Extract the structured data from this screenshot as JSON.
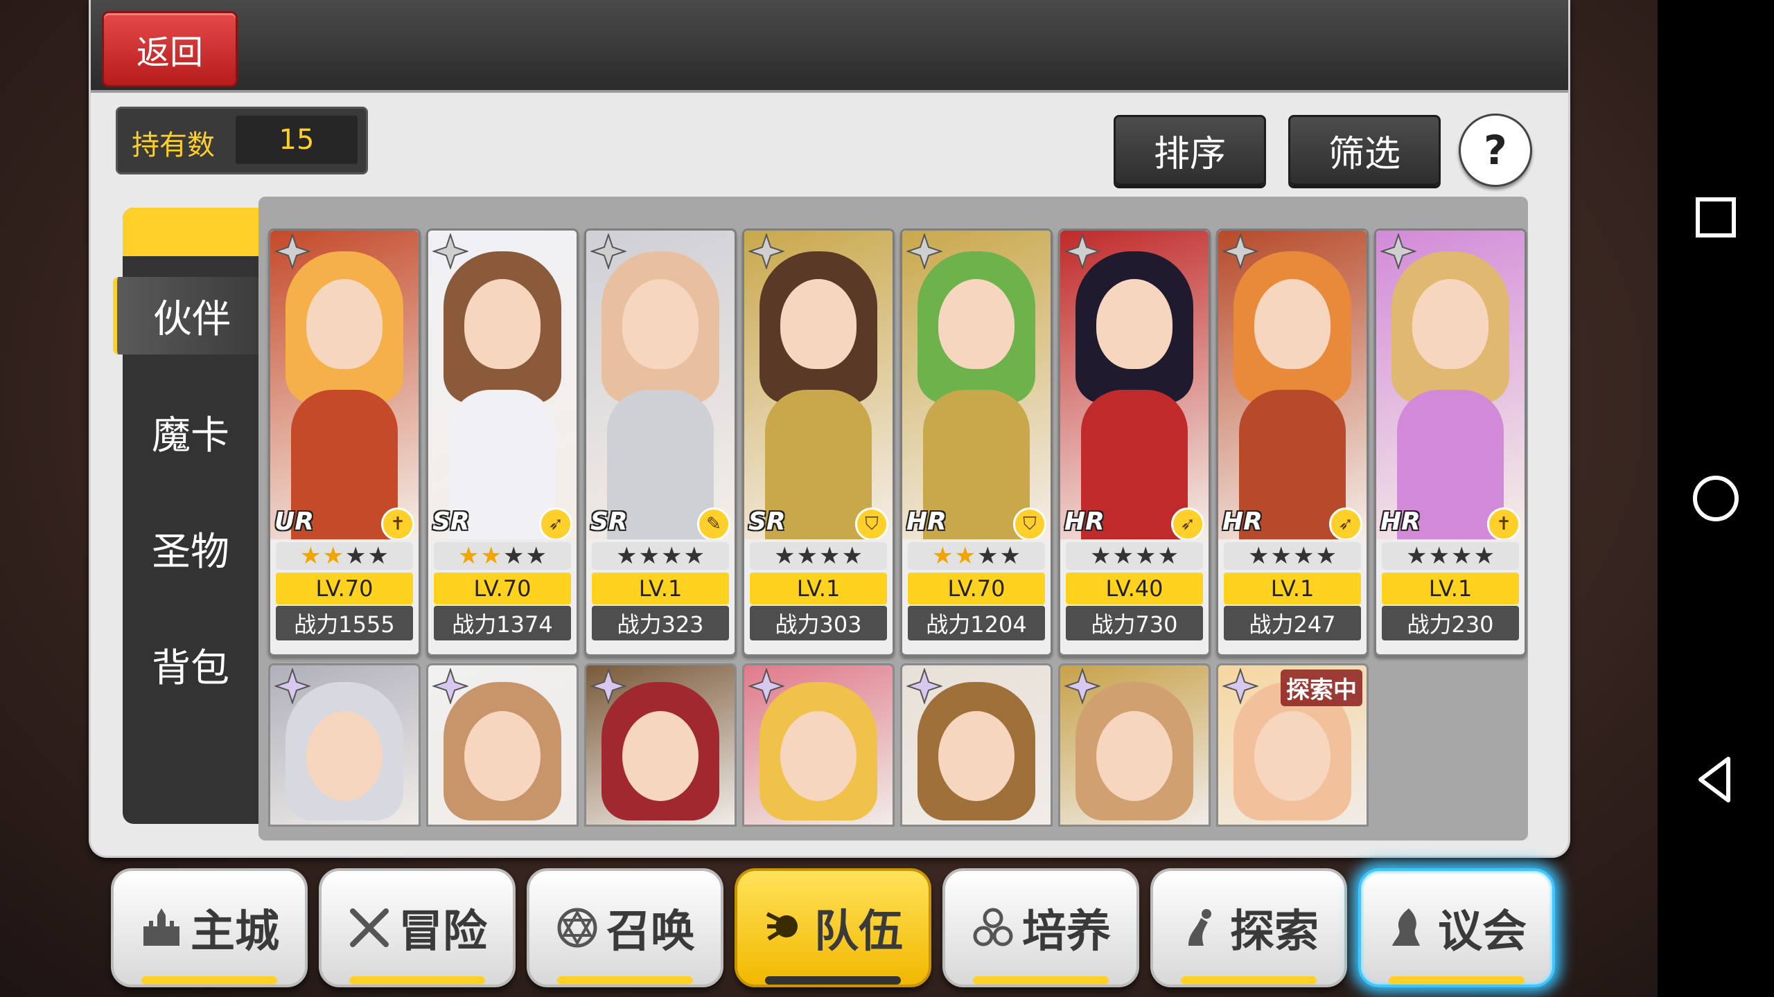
{
  "header": {
    "back_label": "返回"
  },
  "owned": {
    "label": "持有数",
    "value": "15"
  },
  "toolbar": {
    "sort_label": "排序",
    "filter_label": "筛选",
    "help_label": "?"
  },
  "side_tabs": [
    {
      "label": "伙伴",
      "active": true
    },
    {
      "label": "魔卡",
      "active": false
    },
    {
      "label": "圣物",
      "active": false
    },
    {
      "label": "背包",
      "active": false
    }
  ],
  "cards": [
    {
      "rarity": "UR",
      "stars_filled": 2,
      "level": "LV.70",
      "power": "战力1555",
      "palette": [
        "#f6b04a",
        "#c44a2a"
      ],
      "class": "healer"
    },
    {
      "rarity": "SR",
      "stars_filled": 2,
      "level": "LV.70",
      "power": "战力1374",
      "palette": [
        "#8a5a3a",
        "#f0f0f5"
      ],
      "class": "archer"
    },
    {
      "rarity": "SR",
      "stars_filled": 0,
      "level": "LV.1",
      "power": "战力323",
      "palette": [
        "#e8c0a0",
        "#cfcfd6"
      ],
      "class": "mage"
    },
    {
      "rarity": "SR",
      "stars_filled": 0,
      "level": "LV.1",
      "power": "战力303",
      "palette": [
        "#5a3a26",
        "#c9a84c"
      ],
      "class": "knight"
    },
    {
      "rarity": "HR",
      "stars_filled": 2,
      "level": "LV.70",
      "power": "战力1204",
      "palette": [
        "#6db24a",
        "#c9a84c"
      ],
      "class": "knight"
    },
    {
      "rarity": "HR",
      "stars_filled": 0,
      "level": "LV.40",
      "power": "战力730",
      "palette": [
        "#1f1a2e",
        "#c02a2a"
      ],
      "class": "archer"
    },
    {
      "rarity": "HR",
      "stars_filled": 0,
      "level": "LV.1",
      "power": "战力247",
      "palette": [
        "#e88a3a",
        "#b74a2a"
      ],
      "class": "archer"
    },
    {
      "rarity": "HR",
      "stars_filled": 0,
      "level": "LV.1",
      "power": "战力230",
      "palette": [
        "#e0b870",
        "#d28ad8"
      ],
      "class": "healer"
    }
  ],
  "mini_cards": [
    {
      "palette": [
        "#d8d8e0",
        "#b0b0bb"
      ]
    },
    {
      "palette": [
        "#c8956a",
        "#f0f0f0"
      ]
    },
    {
      "palette": [
        "#a0282e",
        "#7a5a3a"
      ]
    },
    {
      "palette": [
        "#f0c24a",
        "#e07a8a"
      ]
    },
    {
      "palette": [
        "#a0703a",
        "#e8e0d8"
      ]
    },
    {
      "palette": [
        "#d0a070",
        "#c8a24a"
      ]
    },
    {
      "palette": [
        "#f2c09a",
        "#f6d6a0"
      ],
      "tag": "探索中"
    }
  ],
  "bottom_nav": [
    {
      "label": "主城",
      "icon": "castle-icon"
    },
    {
      "label": "冒险",
      "icon": "crossed-swords-icon"
    },
    {
      "label": "召唤",
      "icon": "hexagram-icon"
    },
    {
      "label": "队伍",
      "icon": "team-icon",
      "active": true
    },
    {
      "label": "培养",
      "icon": "circles-icon"
    },
    {
      "label": "探索",
      "icon": "explore-icon"
    },
    {
      "label": "议会",
      "icon": "council-icon",
      "glow": true
    }
  ],
  "colors": {
    "accent": "#ffcf2a",
    "back": "#d33030",
    "glow": "#39c4ff"
  }
}
